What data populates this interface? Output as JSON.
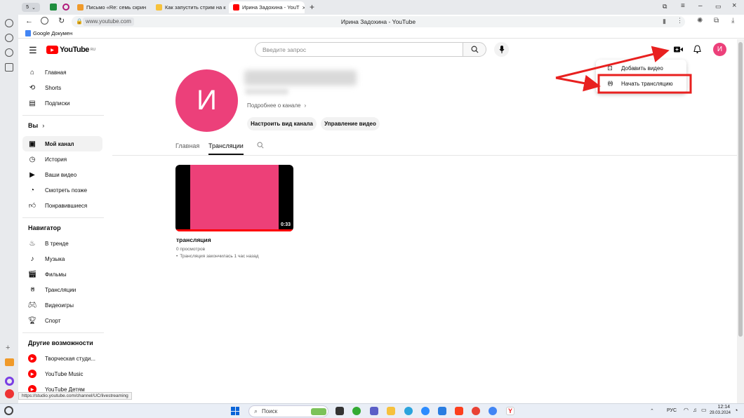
{
  "browser": {
    "tabs": [
      {
        "label": "Письмо «Re: семь скрин"
      },
      {
        "label": "Как запустить стрим на к"
      },
      {
        "label": "Ирина Задохина - YouT"
      }
    ],
    "tab_count_badge": "5",
    "address": "www.youtube.com",
    "page_title": "Ирина Задохина - YouTube",
    "bookmark": "Google Докумен",
    "status_url": "https://studio.youtube.com/channel/UC/livestreaming"
  },
  "youtube": {
    "logo_text": "YouTube",
    "logo_region": "RU",
    "search_placeholder": "Введите запрос",
    "avatar_letter": "И",
    "create_menu": {
      "items": [
        {
          "label": "Добавить видео",
          "icon": "upload-icon"
        },
        {
          "label": "Начать трансляцию",
          "icon": "live-icon"
        }
      ]
    },
    "sidebar": {
      "main": [
        {
          "label": "Главная",
          "icon": "home-icon"
        },
        {
          "label": "Shorts",
          "icon": "shorts-icon"
        },
        {
          "label": "Подписки",
          "icon": "subscriptions-icon"
        }
      ],
      "you_header": "Вы",
      "you": [
        {
          "label": "Мой канал",
          "icon": "channel-icon"
        },
        {
          "label": "История",
          "icon": "history-icon"
        },
        {
          "label": "Ваши видео",
          "icon": "your-videos-icon"
        },
        {
          "label": "Смотреть позже",
          "icon": "watch-later-icon"
        },
        {
          "label": "Понравившиеся",
          "icon": "like-icon"
        }
      ],
      "nav_header": "Навигатор",
      "nav": [
        {
          "label": "В тренде",
          "icon": "trending-icon"
        },
        {
          "label": "Музыка",
          "icon": "music-icon"
        },
        {
          "label": "Фильмы",
          "icon": "movies-icon"
        },
        {
          "label": "Трансляции",
          "icon": "live-icon"
        },
        {
          "label": "Видеоигры",
          "icon": "gaming-icon"
        },
        {
          "label": "Спорт",
          "icon": "sports-icon"
        }
      ],
      "more_header": "Другие возможности",
      "more": [
        {
          "label": "Творческая студи...",
          "icon": "studio-icon"
        },
        {
          "label": "YouTube Music",
          "icon": "yt-music-icon"
        },
        {
          "label": "YouTube Детям",
          "icon": "yt-kids-icon"
        }
      ]
    },
    "channel": {
      "avatar_letter": "И",
      "more_link": "Подробнее о канале",
      "customize_button": "Настроить вид канала",
      "manage_button": "Управление видео",
      "tabs": [
        {
          "label": "Главная",
          "active": false
        },
        {
          "label": "Трансляции",
          "active": true
        }
      ]
    },
    "video": {
      "title": "трансляция",
      "views": "0 просмотров",
      "status": "Трансляция закончилась 1 час назад",
      "duration": "0:33",
      "thumb_color": "#ed4078"
    }
  },
  "taskbar": {
    "search_label": "Поиск",
    "lang": "РУС",
    "time": "12:14",
    "date": "29.03.2024"
  },
  "colors": {
    "avatar": "#ec407a",
    "youtube_red": "#ff0000",
    "annotation_red": "#e8201f"
  }
}
